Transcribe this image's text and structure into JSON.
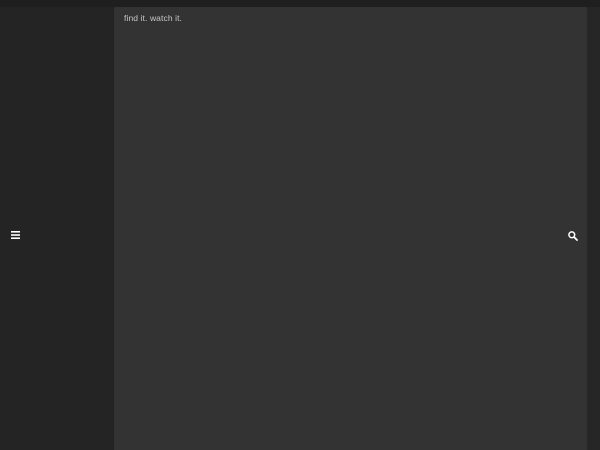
{
  "header": {
    "tagline": "find it. watch it."
  },
  "icons": {
    "menu": "hamburger-menu-icon",
    "search": "search-icon"
  },
  "colors": {
    "background": "#232323",
    "panel": "#333333",
    "icon": "#ffffff",
    "text": "#c8c8c8"
  }
}
